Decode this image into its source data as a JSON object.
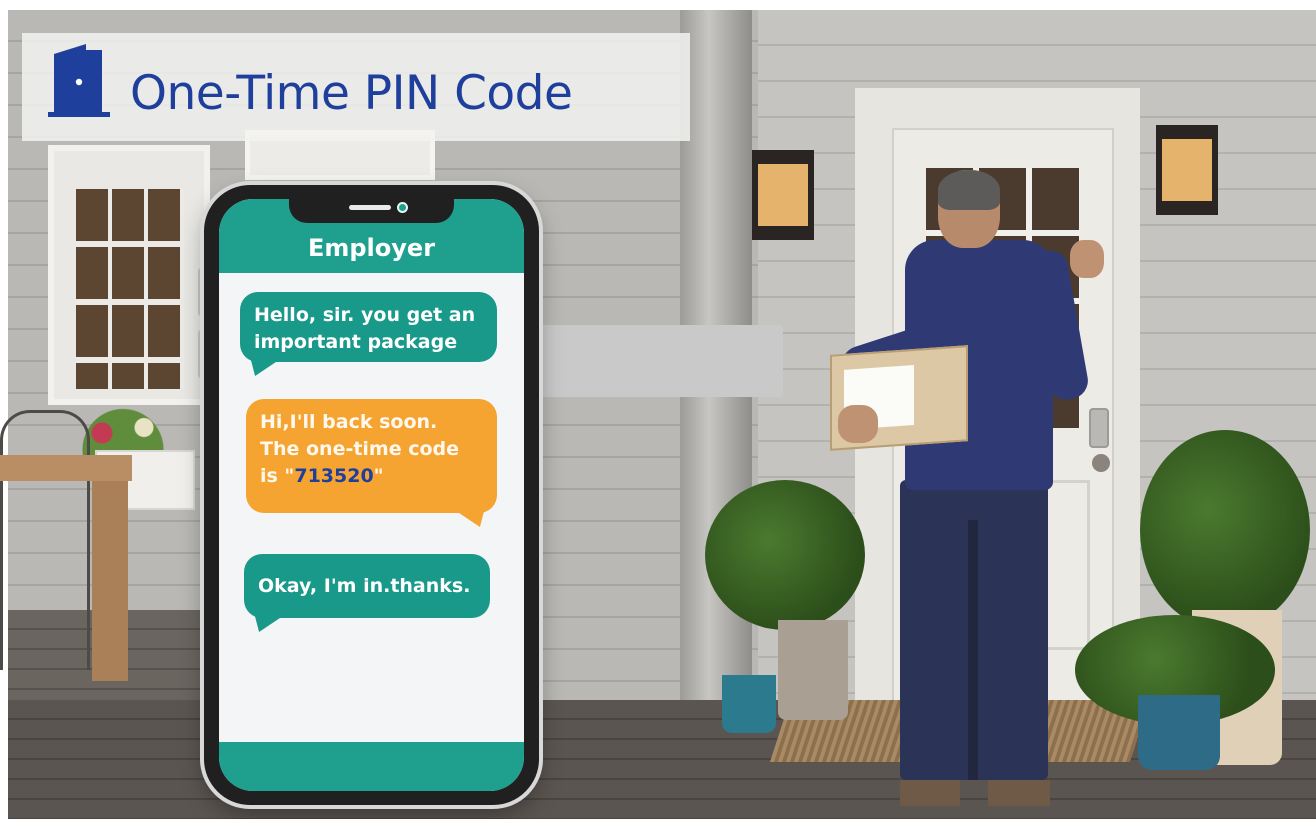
{
  "banner": {
    "title": "One-Time PIN Code",
    "icon": "door-icon",
    "title_color": "#1f3f9c"
  },
  "phone": {
    "contact": "Employer",
    "accent_color": "#1fa08f",
    "messages": [
      {
        "side": "incoming",
        "color": "#19998a",
        "text": "Hello, sir. you get an important package"
      },
      {
        "side": "outgoing",
        "color": "#f5a431",
        "text_before": "Hi,I'll back soon. The one-time code is \"",
        "code": "713520",
        "text_after": "\""
      },
      {
        "side": "incoming",
        "color": "#19998a",
        "text": "Okay, I'm in.thanks."
      }
    ]
  }
}
